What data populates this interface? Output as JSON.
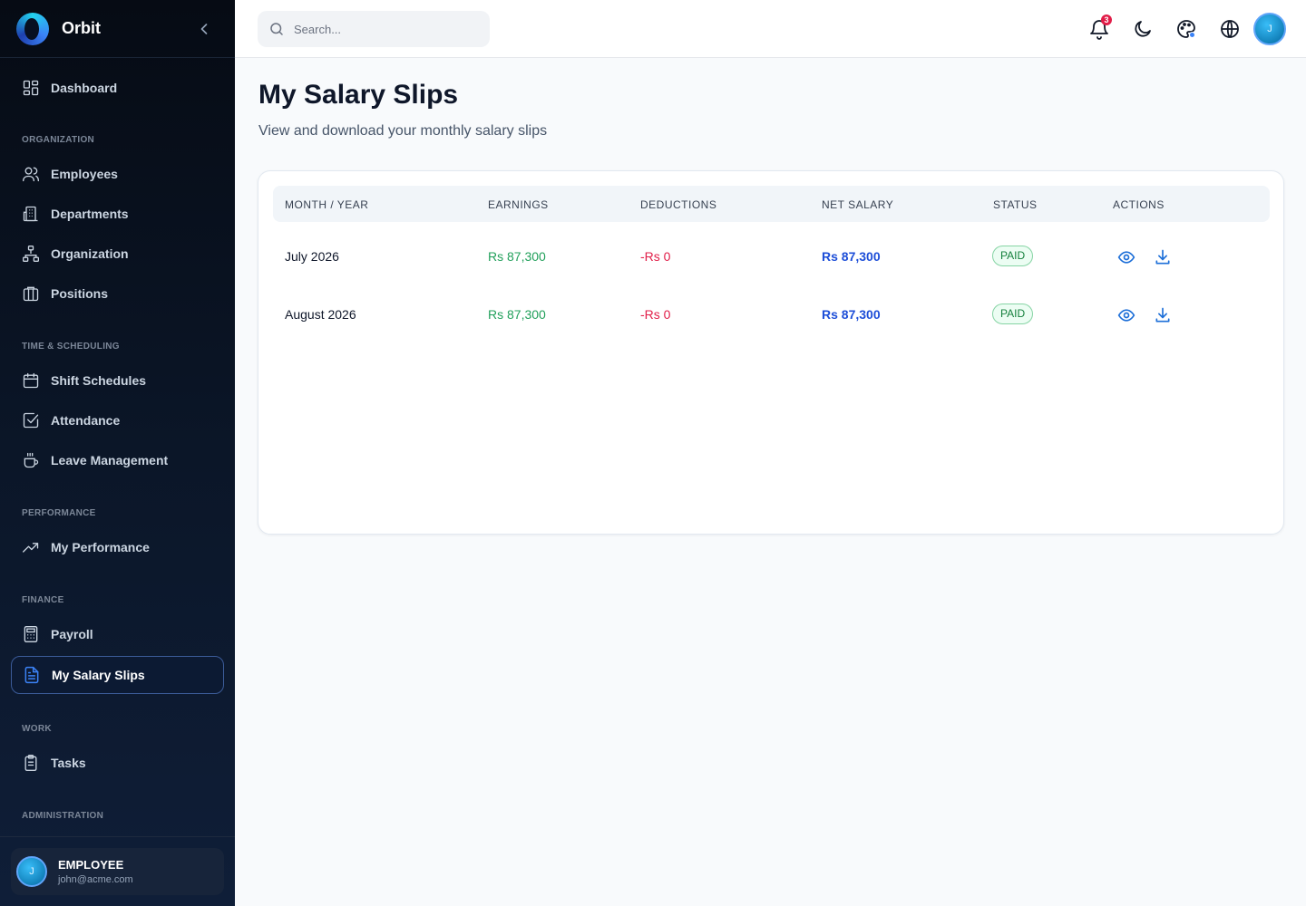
{
  "app": {
    "name": "Orbit"
  },
  "sidebar": {
    "dashboard": "Dashboard",
    "sections": {
      "organization": "ORGANIZATION",
      "time": "TIME & SCHEDULING",
      "performance": "PERFORMANCE",
      "finance": "FINANCE",
      "work": "WORK",
      "administration": "ADMINISTRATION"
    },
    "items": {
      "employees": "Employees",
      "departments": "Departments",
      "organization": "Organization",
      "positions": "Positions",
      "shift_schedules": "Shift Schedules",
      "attendance": "Attendance",
      "leave_management": "Leave Management",
      "my_performance": "My Performance",
      "payroll": "Payroll",
      "my_salary_slips": "My Salary Slips",
      "tasks": "Tasks"
    },
    "active": "my_salary_slips",
    "user": {
      "initial": "J",
      "role": "EMPLOYEE",
      "email": "john@acme.com"
    }
  },
  "topbar": {
    "search_placeholder": "Search...",
    "notification_count": "3",
    "avatar_initial": "J"
  },
  "page": {
    "title": "My Salary Slips",
    "subtitle": "View and download your monthly salary slips"
  },
  "table": {
    "columns": {
      "month": "MONTH / YEAR",
      "earnings": "EARNINGS",
      "deductions": "DEDUCTIONS",
      "net": "NET SALARY",
      "status": "STATUS",
      "actions": "ACTIONS"
    },
    "rows": [
      {
        "month": "July 2026",
        "earnings": "Rs 87,300",
        "deductions": "-Rs 0",
        "net": "Rs 87,300",
        "status": "PAID"
      },
      {
        "month": "August 2026",
        "earnings": "Rs 87,300",
        "deductions": "-Rs 0",
        "net": "Rs 87,300",
        "status": "PAID"
      }
    ]
  },
  "colors": {
    "sidebar_bg": "#0b1628",
    "earnings": "#22a05b",
    "deductions": "#e11d48",
    "net": "#1d4ed8",
    "status_paid": "#15803d",
    "accent": "#3b82f6"
  }
}
